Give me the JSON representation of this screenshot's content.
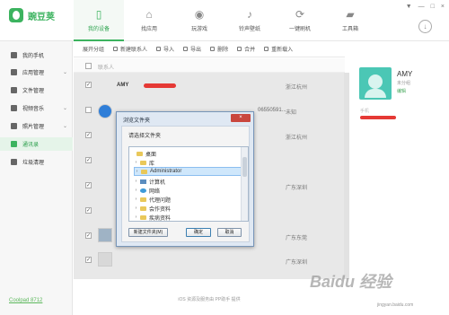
{
  "app": {
    "title": "豌豆荚",
    "accent": "#3cb35f"
  },
  "navigation": [
    {
      "label": "我的设备",
      "icon": "device-icon"
    },
    {
      "label": "找应用",
      "icon": "find-app-icon"
    },
    {
      "label": "玩游戏",
      "icon": "game-icon"
    },
    {
      "label": "铃声壁纸",
      "icon": "music-icon"
    },
    {
      "label": "一键刷机",
      "icon": "refresh-icon"
    },
    {
      "label": "工具箱",
      "icon": "toolbox-icon"
    }
  ],
  "window_controls": [
    "▼",
    "—",
    "□",
    "×"
  ],
  "sidebar": {
    "items": [
      {
        "label": "我的手机",
        "icon": "phone-icon"
      },
      {
        "label": "应用管理",
        "icon": "apps-icon"
      },
      {
        "label": "文件管理",
        "icon": "folder-icon"
      },
      {
        "label": "视频音乐",
        "icon": "video-icon"
      },
      {
        "label": "照片管理",
        "icon": "photo-icon"
      },
      {
        "label": "通讯录",
        "icon": "contacts-icon"
      },
      {
        "label": "垃圾清理",
        "icon": "trash-icon"
      }
    ],
    "connected": "Coolpad 8712"
  },
  "toolbar": [
    "展开分组",
    "新建联系人",
    "导入",
    "导出",
    "删除",
    "合并",
    "重新载入"
  ],
  "table": {
    "head": "联系人",
    "rows": [
      {
        "name": "AMY",
        "city": "浙江杭州"
      },
      {
        "name": "",
        "city": "未知",
        "phone": "06550591..."
      },
      {
        "name": "",
        "city": "浙江杭州"
      },
      {
        "name": "",
        "city": ""
      },
      {
        "name": "",
        "city": "广东深圳"
      },
      {
        "name": "",
        "city": ""
      },
      {
        "name": "",
        "city": "广东东莞"
      },
      {
        "name": "",
        "city": "广东深圳"
      }
    ]
  },
  "detail": {
    "name": "AMY",
    "subtitle": "未分组",
    "edit": "编辑",
    "phone_label": "手机"
  },
  "dialog": {
    "title": "浏览文件夹",
    "close": "×",
    "prompt": "请选择文件夹",
    "items": [
      {
        "label": "桌面",
        "type": "folder"
      },
      {
        "label": "库",
        "type": "folder"
      },
      {
        "label": "Administrator",
        "type": "folder",
        "selected": true
      },
      {
        "label": "计算机",
        "type": "computer"
      },
      {
        "label": "网络",
        "type": "network"
      },
      {
        "label": "代理问题",
        "type": "folder"
      },
      {
        "label": "会作资料",
        "type": "folder"
      },
      {
        "label": "疾病资料",
        "type": "folder"
      }
    ],
    "buttons": [
      "新建文件夹(M)",
      "确定",
      "取消"
    ]
  },
  "footer": "iOS 资源及服务由 PP助手 提供",
  "watermark": "Baidu 经验",
  "watermark_sub": "jingyan.baidu.com"
}
